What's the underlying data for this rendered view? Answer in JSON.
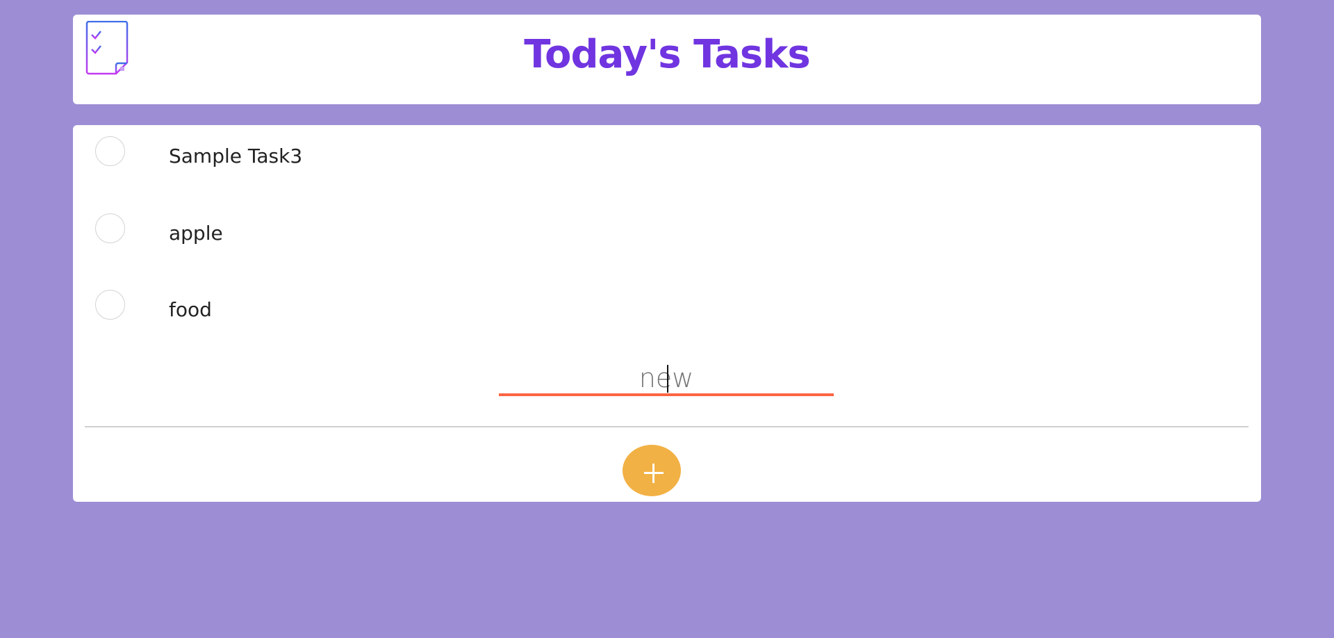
{
  "header": {
    "title": "Today's Tasks",
    "logo_icon": "task-checklist-icon"
  },
  "tasks": [
    {
      "label": "Sample Task3",
      "checked": false
    },
    {
      "label": "apple",
      "checked": false
    },
    {
      "label": "food",
      "checked": false
    }
  ],
  "new_task": {
    "placeholder": "new",
    "value": ""
  },
  "add_button": {
    "icon": "plus-icon"
  },
  "colors": {
    "background": "#9c8dd4",
    "title": "#7035e0",
    "input_underline": "#fc6444",
    "add_button": "#f2b144"
  }
}
